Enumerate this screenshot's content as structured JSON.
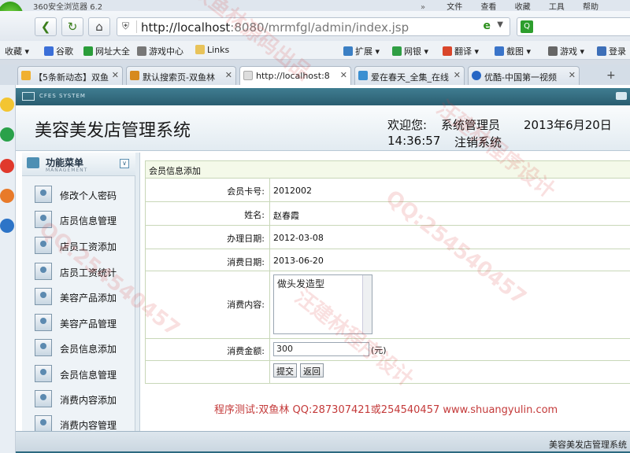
{
  "browser": {
    "app_title": "360安全浏览器 6.2",
    "menus": [
      "文件",
      "查看",
      "收藏",
      "工具",
      "帮助"
    ],
    "url_host": "http://localhost",
    "url_rest": ":8080/mrmfgl/admin/index.jsp",
    "bookmarks": [
      "收藏",
      "谷歌",
      "网址大全",
      "游戏中心",
      "Links",
      "扩展",
      "网银",
      "翻译",
      "截图",
      "游戏",
      "登录"
    ],
    "tabs": [
      "【5条新动态】双鱼",
      "默认搜索页-双鱼林",
      "http://localhost:8",
      "爱在春天_全集_在线",
      "优酷-中国第一视频"
    ],
    "active_tab": 2
  },
  "app": {
    "cfes": "CFES SYSTEM",
    "title": "美容美发店管理系统",
    "welcome": "欢迎您:",
    "user": "系统管理员",
    "date": "2013年6月20日",
    "time": "14:36:57",
    "logout": "注销系统"
  },
  "menu": {
    "title": "功能菜单",
    "subtitle": "MANAGEMENT",
    "items": [
      "修改个人密码",
      "店员信息管理",
      "店员工资添加",
      "店员工资统计",
      "美容产品添加",
      "美容产品管理",
      "会员信息添加",
      "会员信息管理",
      "消费内容添加",
      "消费内容管理"
    ]
  },
  "form": {
    "heading": "会员信息添加",
    "card_label": "会员卡号:",
    "card_value": "2012002",
    "name_label": "姓名:",
    "name_value": "赵春霞",
    "date_label": "办理日期:",
    "date_value": "2012-03-08",
    "consume_date_label": "消费日期:",
    "consume_date_value": "2013-06-20",
    "content_label": "消费内容:",
    "content_value": "做头发造型",
    "amount_label": "消费金额:",
    "amount_value": "300",
    "amount_unit": "(元)",
    "submit": "提交",
    "back": "返回"
  },
  "footer": {
    "note": "程序测试:双鱼林 QQ:287307421或254540457 www.shuangyulin.com",
    "status": "美容美发店管理系统"
  },
  "watermarks": [
    "双鱼林源码出品",
    "QQ:254540457",
    "汪建林程序设计"
  ],
  "colors": {
    "accent": "#2a5d70",
    "panel_border": "#c8d7b8",
    "note": "#c43a3a"
  }
}
